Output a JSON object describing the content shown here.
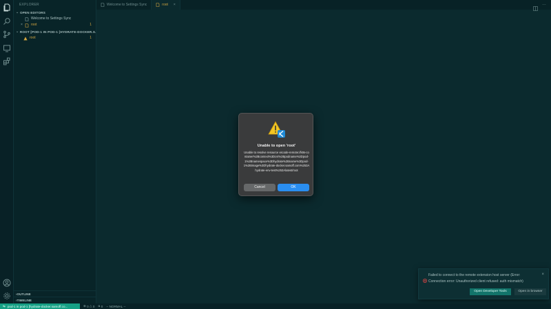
{
  "sidebar": {
    "title": "EXPLORER",
    "open_editors_label": "OPEN EDITORS",
    "open_editors": [
      {
        "label": "Welcome to Settings Sync"
      },
      {
        "label": "root",
        "badge": "1"
      }
    ],
    "root_section_label": "ROOT [POD-1 IN POD-1 [HYDRATE-DOCKER.S...",
    "root_items": [
      {
        "label": "root",
        "badge": "1"
      }
    ],
    "outline_label": "OUTLINE",
    "timeline_label": "TIMELINE"
  },
  "tabs": [
    {
      "label": "Welcome to Settings Sync",
      "active": false
    },
    {
      "label": "root",
      "active": true
    }
  ],
  "dialog": {
    "title": "Unable to open 'root'",
    "message": "Unable to resolve resource vscode-remote://k8s-container%2Bcontext%3Dcvt%2Bpodname%3Dpod-1%2Bnamespace%3Dhydrate%2Bname%3Dpod-1%2Bimage%3Dhydrate-docker.samoff.com%253Ahydrate-env-test%253Alatest/root",
    "cancel_label": "Cancel",
    "ok_label": "OK"
  },
  "notification": {
    "message": "Failed to connect to the remote extension host server (Error: Connection error: Unauthorized client refused: auth mismatch)",
    "primary_button": "Open Developer Tools",
    "secondary_button": "Open in browser"
  },
  "statusbar": {
    "remote_label": "pod-1 in pod-1 [hydrate-docker.samoff.co...",
    "errors": "0",
    "warnings": "0",
    "ports": "0",
    "mode": "-- NORMAL --"
  },
  "colors": {
    "accent": "#16a085",
    "editor_bg": "#0b2a2e",
    "ok_button": "#2a8ef0",
    "warning": "#f3c623",
    "error": "#e04646"
  }
}
